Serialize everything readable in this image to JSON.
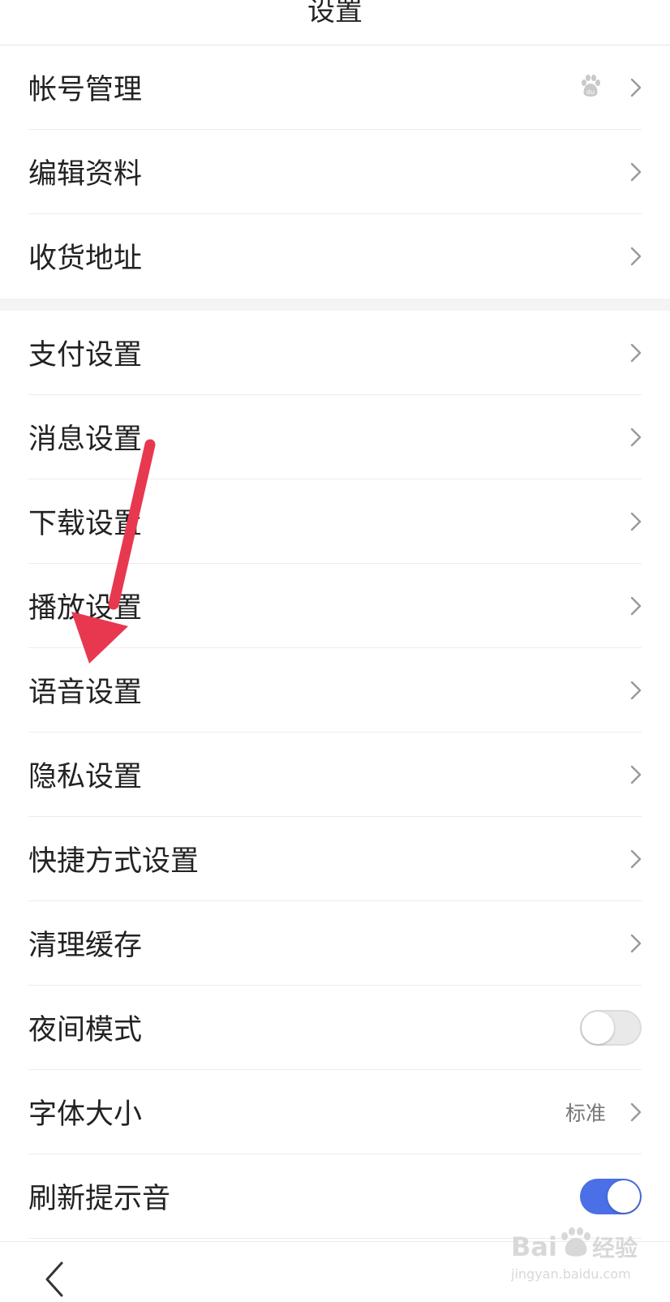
{
  "header": {
    "title": "设置"
  },
  "group1": [
    {
      "label": "帐号管理",
      "icon": "baidu-paw-icon"
    },
    {
      "label": "编辑资料"
    },
    {
      "label": "收货地址"
    }
  ],
  "group2": [
    {
      "label": "支付设置"
    },
    {
      "label": "消息设置"
    },
    {
      "label": "下载设置"
    },
    {
      "label": "播放设置"
    },
    {
      "label": "语音设置"
    },
    {
      "label": "隐私设置"
    },
    {
      "label": "快捷方式设置"
    },
    {
      "label": "清理缓存"
    },
    {
      "label": "夜间模式",
      "toggle": false
    },
    {
      "label": "字体大小",
      "value": "标准"
    },
    {
      "label": "刷新提示音",
      "toggle": true
    }
  ],
  "colors": {
    "accent": "#4b6fe6",
    "annotation_arrow": "#e8384f"
  },
  "watermark": {
    "brand": "Bai",
    "brand2": "经验",
    "url": "jingyan.baidu.com"
  }
}
